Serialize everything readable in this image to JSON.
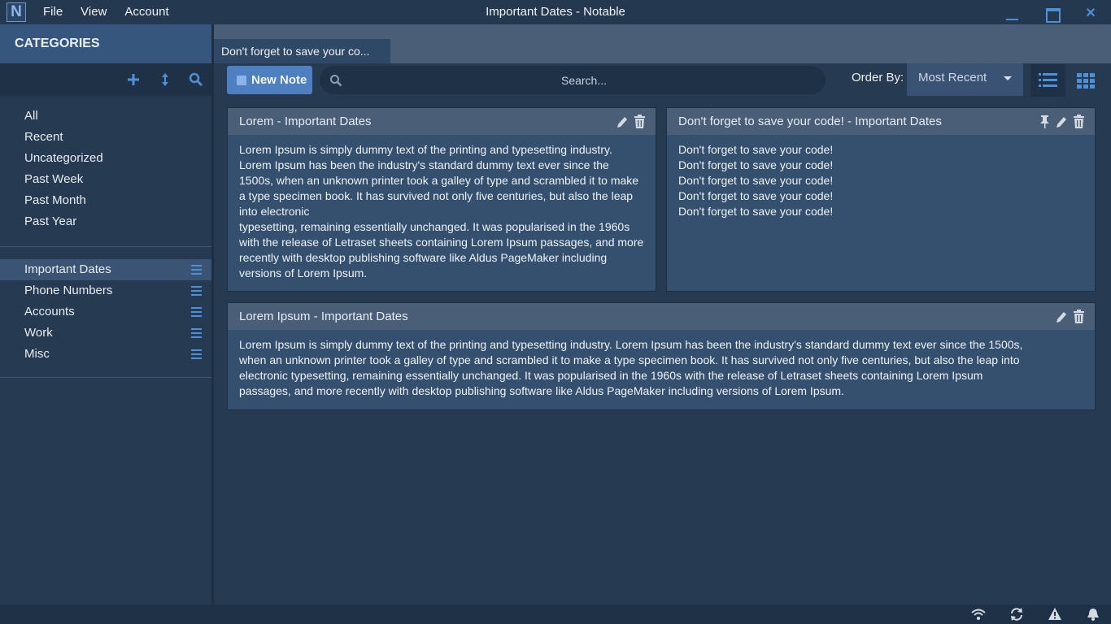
{
  "app": {
    "logo_letter": "N",
    "window_title": "Important Dates - Notable",
    "menu": [
      "File",
      "View",
      "Account"
    ],
    "accent_color": "#4f8fd6"
  },
  "sidebar": {
    "header": "CATEGORIES",
    "tools": [
      "add-icon",
      "sort-icon",
      "search-icon"
    ],
    "filters": [
      "All",
      "Recent",
      "Uncategorized",
      "Past Week",
      "Past Month",
      "Past Year"
    ],
    "categories": [
      {
        "label": "Important Dates",
        "active": true
      },
      {
        "label": "Phone Numbers",
        "active": false
      },
      {
        "label": "Accounts",
        "active": false
      },
      {
        "label": "Work",
        "active": false
      },
      {
        "label": "Misc",
        "active": false
      }
    ]
  },
  "tabs": [
    {
      "label": "Don't forget to save your co..."
    }
  ],
  "toolbar": {
    "new_note_label": "New Note",
    "search_placeholder": "Search...",
    "order_by_label": "Order By:",
    "order_by_value": "Most Recent"
  },
  "notes": [
    {
      "title": "Lorem  -  Important Dates",
      "pinned": false,
      "lines": [
        "Lorem Ipsum is simply dummy text of the printing and typesetting industry. Lorem Ipsum has been the industry's standard dummy text ever since the 1500s, when an unknown printer took a galley of type and scrambled it to make a type specimen book. It has survived not only five centuries, but also the leap into electronic",
        "typesetting, remaining essentially unchanged. It was popularised in the 1960s with the release of Letraset sheets containing Lorem Ipsum passages, and more recently with desktop publishing software like Aldus PageMaker including versions of Lorem Ipsum."
      ]
    },
    {
      "title": "Don't forget to save your code!  -  Important Dates",
      "pinned": true,
      "lines": [
        "Don't forget to save your code!",
        "Don't forget to save your code!",
        "Don't forget to save your code!",
        "Don't forget to save your code!",
        "Don't forget to save your code!"
      ]
    },
    {
      "title": "Lorem Ipsum  -  Important Dates",
      "pinned": false,
      "lines": [
        "Lorem Ipsum is simply dummy text of the printing and typesetting industry. Lorem Ipsum has been the industry's standard dummy text ever since the 1500s, when an unknown printer took a galley of type and scrambled it to make a type specimen book. It has survived not only five centuries, but also the leap into electronic typesetting, remaining essentially unchanged. It was popularised in the 1960s with the release of Letraset sheets containing Lorem Ipsum passages, and more recently with desktop publishing software like Aldus PageMaker including versions of Lorem Ipsum."
      ]
    }
  ],
  "statusbar": {
    "icons": [
      "wifi-icon",
      "sync-icon",
      "warning-icon",
      "bell-icon"
    ]
  }
}
